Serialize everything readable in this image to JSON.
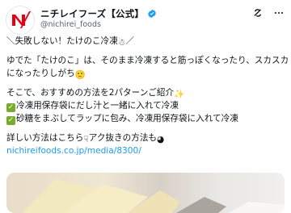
{
  "tweet": {
    "display_name": "ニチレイフーズ【公式】",
    "handle": "@nichirei_foods",
    "lines": [
      "＼失敗しない！たけのこ冷凍",
      "ゆでた「たけのこ」は、そのまま冷凍すると筋っぽくなったり、スカスカ",
      "になったりしがち",
      "そこで、おすすめの方法を2パターンご紹介",
      "冷凍用保存袋にだし汁と一緒に入れて冷凍",
      "砂糖をまぶしてラップに包み、冷凍用保存袋に入れて冷凍",
      "詳しい方法はこちら",
      "アク抜きの方法も"
    ],
    "link_text": "nichireifoods.co.jp/media/8300/"
  },
  "colors": {
    "link": "#1d9bf0",
    "brand_red": "#e60012",
    "check_green": "#7aac2c"
  },
  "icons": [
    "verified-badge-icon",
    "grok-icon",
    "more-icon",
    "snowman-icon",
    "sparkles-icon",
    "pointing-icon",
    "bowl-icon"
  ]
}
